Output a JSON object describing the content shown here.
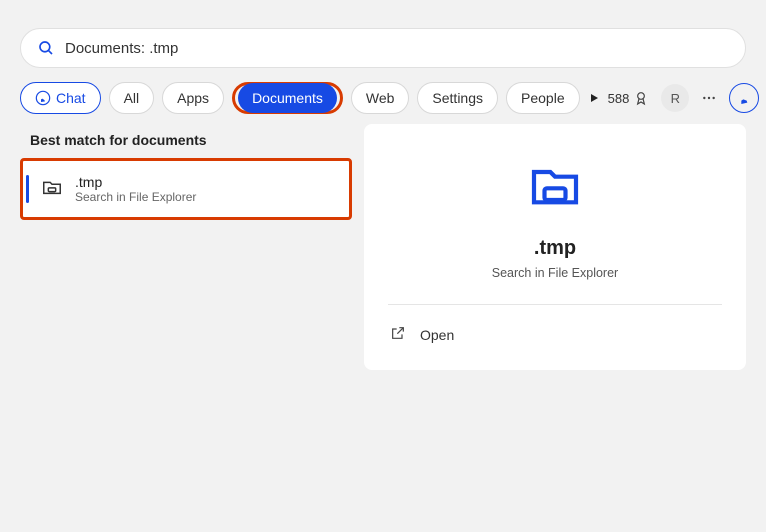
{
  "search": {
    "value": "Documents: .tmp"
  },
  "filters": {
    "chat": "Chat",
    "all": "All",
    "apps": "Apps",
    "documents": "Documents",
    "web": "Web",
    "settings": "Settings",
    "people": "People"
  },
  "toolbar": {
    "points": "588",
    "avatar_initial": "R"
  },
  "results": {
    "header": "Best match for documents",
    "item": {
      "title": ".tmp",
      "subtitle": "Search in File Explorer"
    }
  },
  "preview": {
    "title": ".tmp",
    "subtitle": "Search in File Explorer",
    "action_open": "Open"
  }
}
